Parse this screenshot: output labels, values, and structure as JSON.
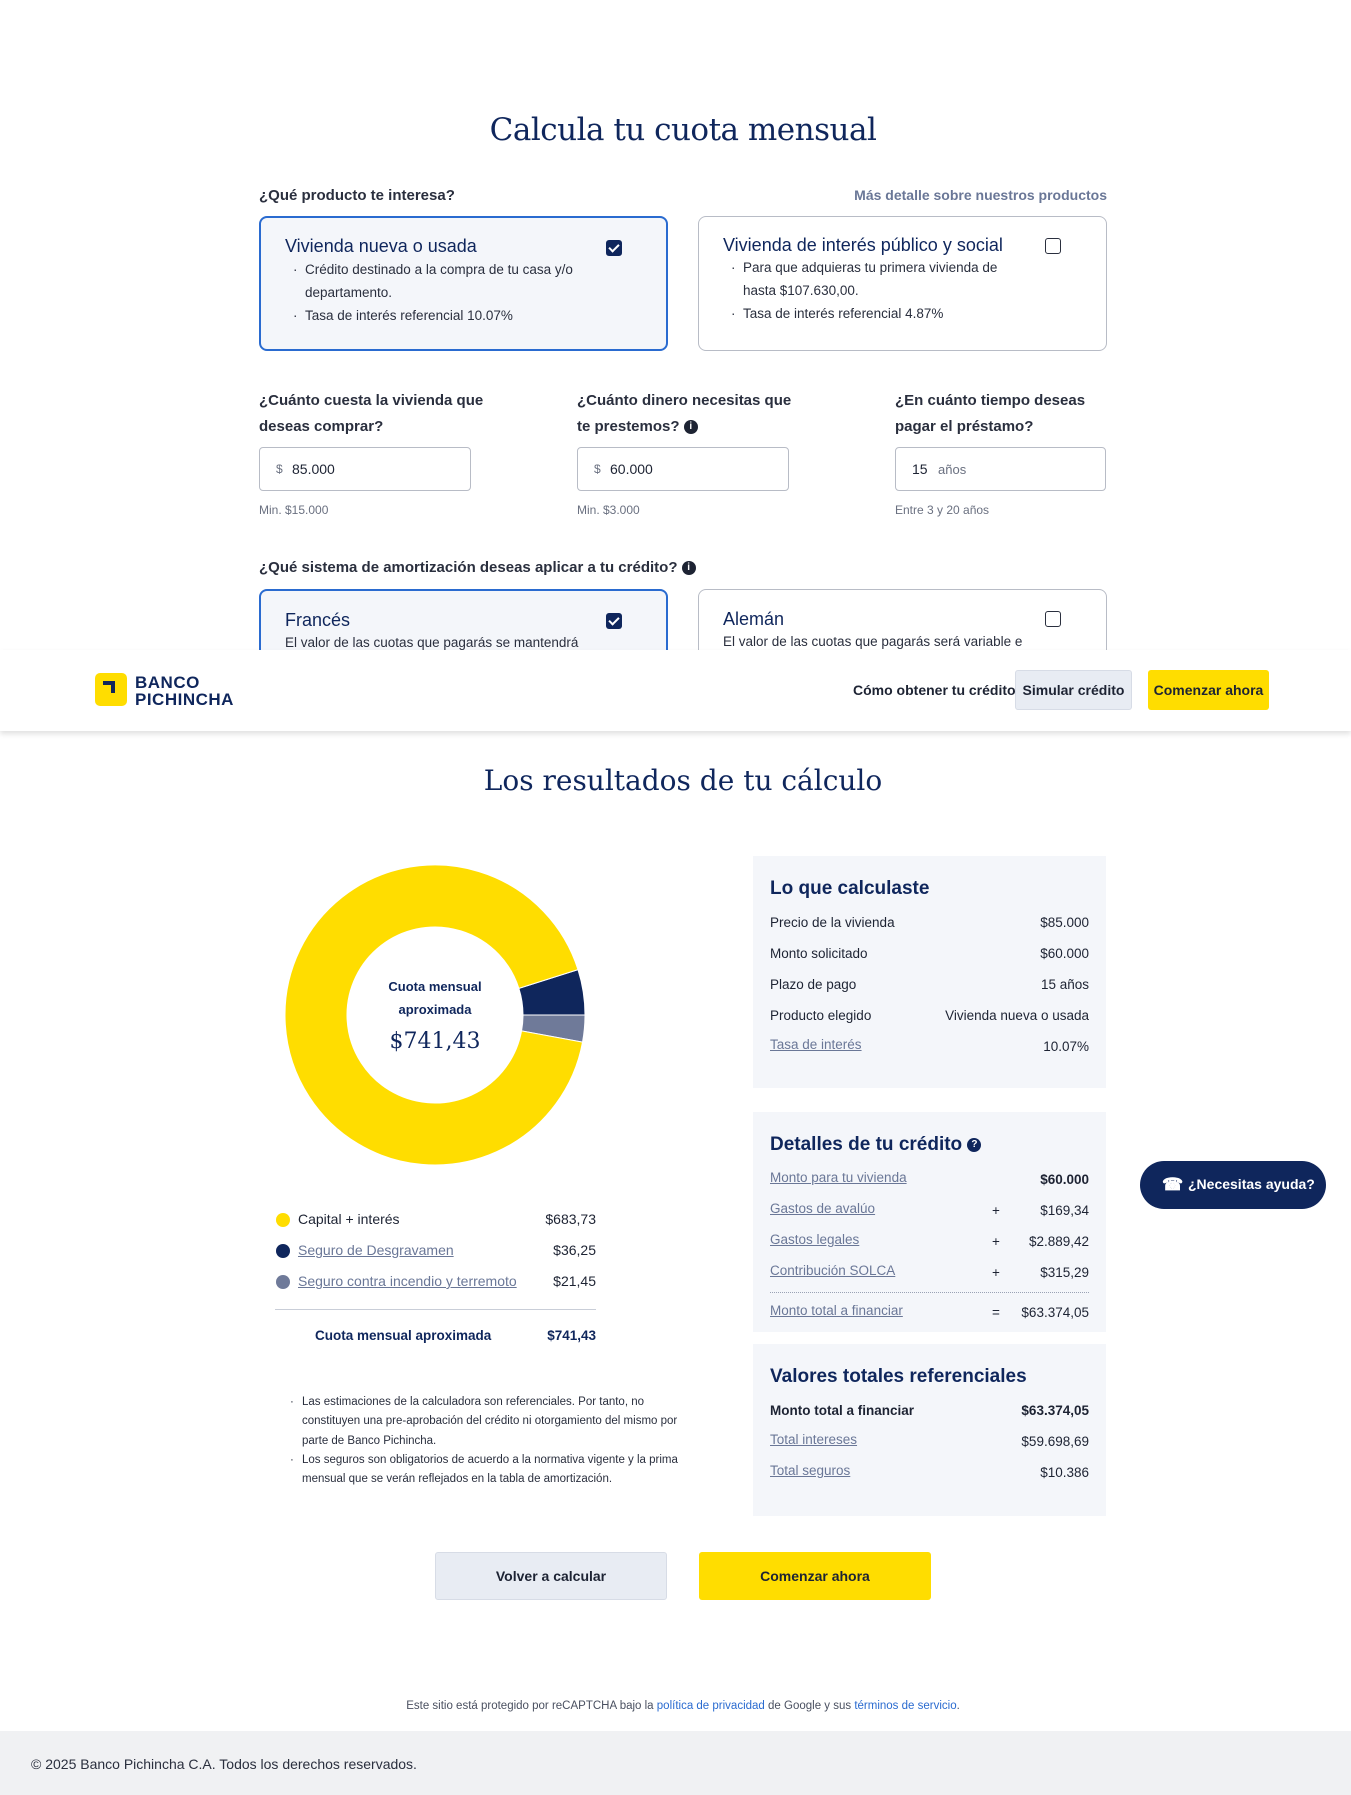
{
  "calculator": {
    "title": "Calcula tu cuota mensual",
    "product_question": "¿Qué producto te interesa?",
    "product_link": "Más detalle sobre nuestros productos",
    "products": [
      {
        "title": "Vivienda nueva o usada",
        "bullets": [
          "Crédito destinado a la compra de tu casa y/o departamento.",
          "Tasa de interés referencial 10.07%"
        ],
        "selected": true
      },
      {
        "title": "Vivienda de interés público y social",
        "bullets": [
          "Para que adquieras tu primera vivienda de hasta $107.630,00.",
          "Tasa de interés referencial 4.87%"
        ],
        "selected": false
      }
    ],
    "price_question_1": "¿Cuánto cuesta la vivienda que",
    "price_question_2": "deseas comprar?",
    "price_prefix": "$",
    "price_value": "85.000",
    "price_hint": "Min. $15.000",
    "loan_question_1": "¿Cuánto dinero necesitas que",
    "loan_question_2": "te prestemos?",
    "loan_prefix": "$",
    "loan_value": "60.000",
    "loan_hint": "Min. $3.000",
    "term_question_1": "¿En cuánto tiempo deseas",
    "term_question_2": "pagar el préstamo?",
    "term_value": "15",
    "term_suffix": "años",
    "term_hint": "Entre 3 y 20 años",
    "amort_question": "¿Qué sistema de amortización deseas aplicar a tu crédito?",
    "amort_options": [
      {
        "title": "Francés",
        "desc": "El valor de las cuotas que pagarás se mantendrá",
        "selected": true
      },
      {
        "title": "Alemán",
        "desc": "El valor de las cuotas que pagarás será variable e",
        "selected": false
      }
    ]
  },
  "header": {
    "logo_line1": "BANCO",
    "logo_line2": "PICHINCHA",
    "nav_link": "Cómo obtener tu crédito",
    "simulate_button": "Simular crédito",
    "start_button": "Comenzar ahora"
  },
  "results": {
    "title": "Los resultados de tu cálculo",
    "donut_label_1": "Cuota mensual",
    "donut_label_2": "aproximada",
    "donut_value": "$741,43",
    "legend": [
      {
        "label": "Capital + interés",
        "amount": "$683,73",
        "color": "#ffdd00",
        "link": false
      },
      {
        "label": "Seguro de Desgravamen",
        "amount": "$36,25",
        "color": "#0f265c",
        "link": true
      },
      {
        "label": "Seguro contra incendio y terremoto",
        "amount": "$21,45",
        "color": "#6f7a99",
        "link": true
      }
    ],
    "legend_total_label": "Cuota mensual aproximada",
    "legend_total_amount": "$741,43",
    "notes": [
      "Las estimaciones de la calculadora son referenciales. Por tanto, no constituyen una pre-aprobación del crédito ni otorgamiento del mismo por parte de Banco Pichincha.",
      "Los seguros son obligatorios de acuerdo a la normativa vigente y la prima mensual que se verán reflejados en la tabla de amortización."
    ],
    "summary": {
      "title": "Lo que calculaste",
      "rows": [
        {
          "k": "Precio de la vivienda",
          "v": "$85.000"
        },
        {
          "k": "Monto solicitado",
          "v": "$60.000"
        },
        {
          "k": "Plazo de pago",
          "v": "15 años"
        },
        {
          "k": "Producto elegido",
          "v": "Vivienda nueva o usada"
        },
        {
          "k": "Tasa de interés",
          "v": "10.07%"
        }
      ]
    },
    "details": {
      "title": "Detalles de tu crédito",
      "rows": [
        {
          "k": "Monto para tu vivienda",
          "op": "",
          "v": "$60.000"
        },
        {
          "k": "Gastos de avalúo",
          "op": "+",
          "v": "$169,34"
        },
        {
          "k": "Gastos legales",
          "op": "+",
          "v": "$2.889,42"
        },
        {
          "k": "Contribución SOLCA",
          "op": "+",
          "v": "$315,29"
        },
        {
          "k": "Monto total a financiar",
          "op": "=",
          "v": "$63.374,05"
        }
      ]
    },
    "totals": {
      "title": "Valores totales referenciales",
      "rows": [
        {
          "k": "Monto total a financiar",
          "v": "$63.374,05"
        },
        {
          "k": "Total intereses",
          "v": "$59.698,69"
        },
        {
          "k": "Total seguros",
          "v": "$10.386"
        }
      ]
    },
    "recalc_button": "Volver a calcular",
    "start_button": "Comenzar ahora"
  },
  "help_button": "¿Necesitas ayuda?",
  "recaptcha": {
    "before": "Este sitio está protegido por reCAPTCHA bajo la ",
    "privacy": "política de privacidad",
    "middle": " de Google y sus ",
    "terms": "términos de servicio",
    "after": "."
  },
  "footer": "© 2025 Banco Pichincha C.A. Todos los derechos reservados.",
  "colors": {
    "brand_yellow": "#ffdd00",
    "brand_navy": "#0f265c",
    "selected_border": "#2a6bd0"
  },
  "icons": [
    "check-icon",
    "info-icon",
    "question-icon",
    "phone-icon",
    "logo-mark-icon"
  ]
}
